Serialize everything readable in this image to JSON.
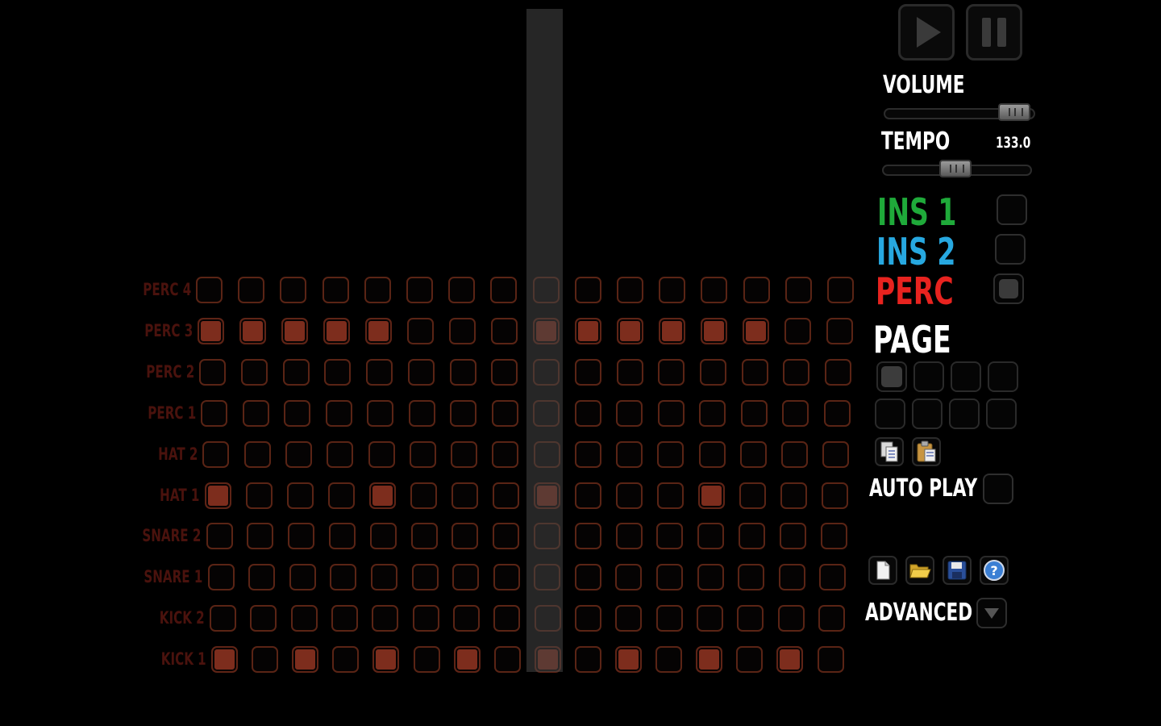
{
  "transport": {
    "play_icon": "play-icon",
    "pause_icon": "pause-icon"
  },
  "volume": {
    "label": "VOLUME",
    "level": 0.9
  },
  "tempo": {
    "label": "TEMPO",
    "value": "133.0",
    "level": 0.5
  },
  "channels": [
    {
      "label": "INS 1",
      "color": "#1faa3a",
      "checked": false
    },
    {
      "label": "INS 2",
      "color": "#27a8e0",
      "checked": false
    },
    {
      "label": "PERC",
      "color": "#e8231f",
      "checked": true
    }
  ],
  "page": {
    "label": "PAGE",
    "active_index": 0,
    "count": 8
  },
  "clipboard": {
    "copy_icon": "copy-icon",
    "paste_icon": "paste-icon"
  },
  "auto_play": {
    "label": "AUTO PLAY",
    "checked": false
  },
  "file_actions": [
    {
      "icon": "new-file-icon"
    },
    {
      "icon": "open-folder-icon"
    },
    {
      "icon": "save-disk-icon"
    },
    {
      "icon": "help-icon"
    }
  ],
  "advanced": {
    "label": "ADVANCED",
    "icon": "triangle-down-icon"
  },
  "sequencer": {
    "steps": 16,
    "playhead_step": 9,
    "rows": [
      {
        "label": "PERC 4",
        "steps": [
          0,
          0,
          0,
          0,
          0,
          0,
          0,
          0,
          0,
          0,
          0,
          0,
          0,
          0,
          0,
          0
        ]
      },
      {
        "label": "PERC 3",
        "steps": [
          1,
          1,
          1,
          1,
          1,
          0,
          0,
          0,
          1,
          1,
          1,
          1,
          1,
          1,
          0,
          0
        ]
      },
      {
        "label": "PERC 2",
        "steps": [
          0,
          0,
          0,
          0,
          0,
          0,
          0,
          0,
          0,
          0,
          0,
          0,
          0,
          0,
          0,
          0
        ]
      },
      {
        "label": "PERC 1",
        "steps": [
          0,
          0,
          0,
          0,
          0,
          0,
          0,
          0,
          0,
          0,
          0,
          0,
          0,
          0,
          0,
          0
        ]
      },
      {
        "label": "HAT 2",
        "steps": [
          0,
          0,
          0,
          0,
          0,
          0,
          0,
          0,
          0,
          0,
          0,
          0,
          0,
          0,
          0,
          0
        ]
      },
      {
        "label": "HAT 1",
        "steps": [
          1,
          0,
          0,
          0,
          1,
          0,
          0,
          0,
          1,
          0,
          0,
          0,
          1,
          0,
          0,
          0
        ]
      },
      {
        "label": "SNARE 2",
        "steps": [
          0,
          0,
          0,
          0,
          0,
          0,
          0,
          0,
          0,
          0,
          0,
          0,
          0,
          0,
          0,
          0
        ]
      },
      {
        "label": "SNARE 1",
        "steps": [
          0,
          0,
          0,
          0,
          0,
          0,
          0,
          0,
          0,
          0,
          0,
          0,
          0,
          0,
          0,
          0
        ]
      },
      {
        "label": "KICK 2",
        "steps": [
          0,
          0,
          0,
          0,
          0,
          0,
          0,
          0,
          0,
          0,
          0,
          0,
          0,
          0,
          0,
          0
        ]
      },
      {
        "label": "KICK 1",
        "steps": [
          1,
          0,
          1,
          0,
          1,
          0,
          1,
          0,
          1,
          0,
          1,
          0,
          1,
          0,
          1,
          0
        ]
      }
    ]
  }
}
